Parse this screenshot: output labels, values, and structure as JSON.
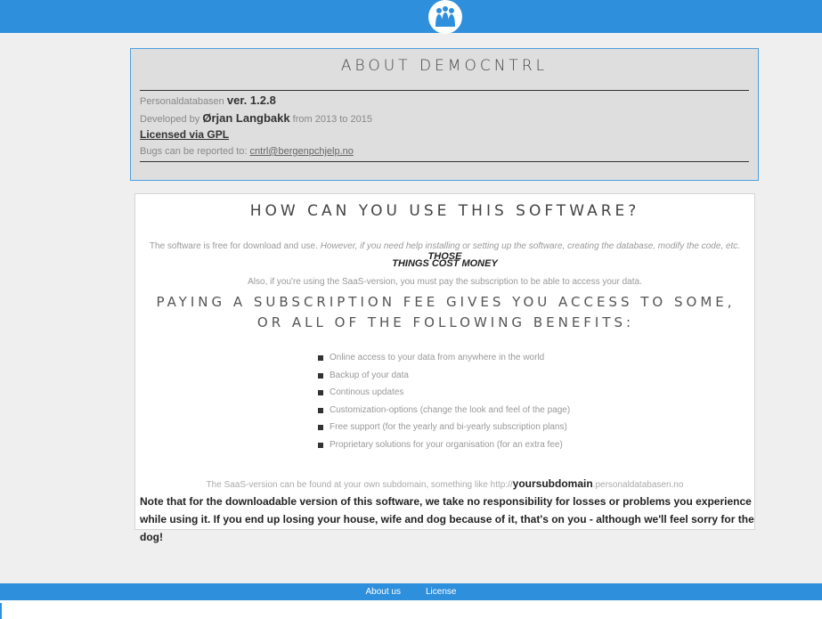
{
  "header": {
    "logo_icon": "people-group-icon"
  },
  "about": {
    "title": "ABOUT DEMOCNTRL",
    "product_prefix": "Personaldatabasen",
    "version": "ver. 1.2.8",
    "developed_prefix": "Developed by",
    "developer": "Ørjan Langbakk",
    "developed_suffix": "from 2013 to 2015",
    "license_link": "Licensed via GPL",
    "bugs_prefix": "Bugs can be reported to:",
    "bugs_email": "cntrl@bergenpchjelp.no"
  },
  "usage": {
    "title": "HOW CAN YOU USE THIS SOFTWARE?",
    "free_text": "The software is free for download and use.",
    "however_text": "However, if you need help installing or setting up the software, creating the database, modify the code, etc.",
    "cost_text_1": "THOSE",
    "cost_text_2": "THINGS COST MONEY",
    "saas_subscription_text": "Also, if you're using the SaaS-version, you must pay the subscription to be able to access your data.",
    "benefits_title": "PAYING A SUBSCRIPTION FEE GIVES YOU ACCESS TO SOME, OR ALL OF THE FOLLOWING BENEFITS:",
    "benefits": [
      "Online access to your data from anywhere in the world",
      "Backup of your data",
      "Continous updates",
      "Customization-options (change the look and feel of the page)",
      "Free support (for the yearly and bi-yearly subscription plans)",
      "Proprietary solutions for your organisation (for an extra fee)"
    ],
    "saas_prefix": "The SaaS-version can be found at your own subdomain, something like http://",
    "saas_subdomain": "yoursubdomain",
    "saas_suffix": ".personaldatabasen.no",
    "note": "Note that for the downloadable version of this software, we take no responsibility for losses or problems you experience while using it. If you end up losing your house, wife and dog because of it, that's on you - although we'll feel sorry for the dog!"
  },
  "footer": {
    "about_link": "About us",
    "license_link": "License"
  }
}
